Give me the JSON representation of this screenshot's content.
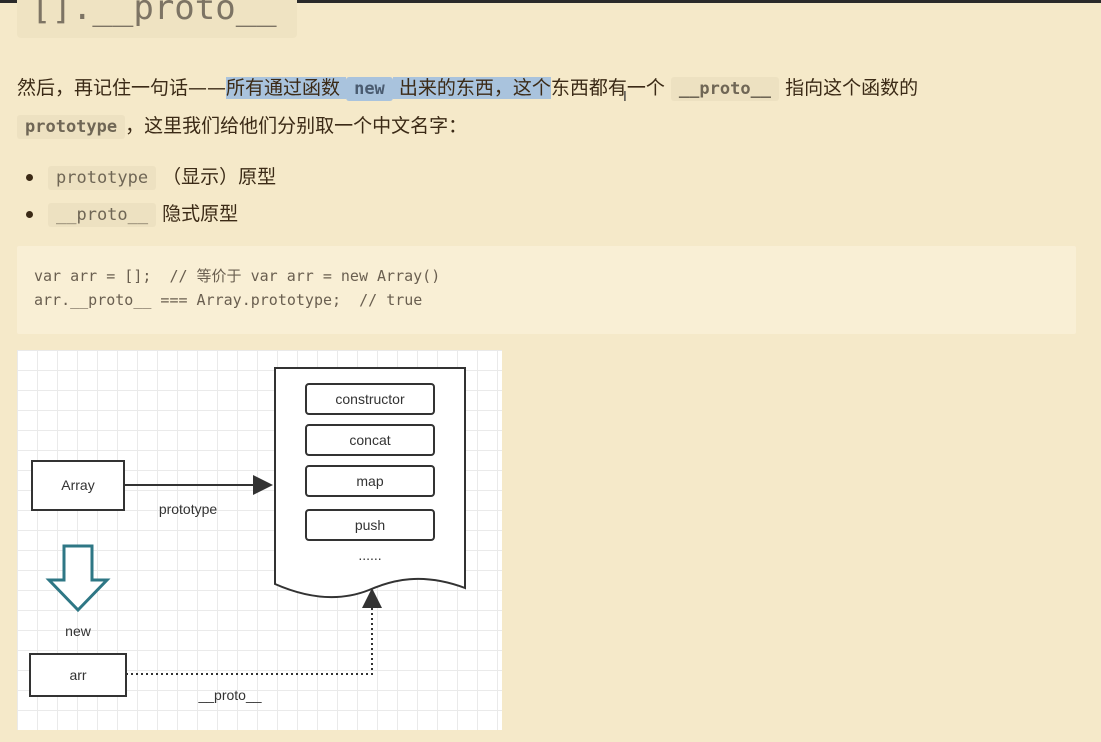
{
  "title": "[].__proto__",
  "paragraph": {
    "seg1": "然后，再记住一句话——",
    "seg2_hl": "所有通过函数",
    "code_new": "new",
    "seg3_hl": "出来的东西，这个",
    "seg4": "东西都有一个",
    "code_proto": "__proto__",
    "seg5": "指向这个函数的",
    "code_prototype": "prototype",
    "seg6": "，这里我们给他们分别取一个中文名字："
  },
  "bullets": [
    {
      "code": "prototype",
      "text": "（显示）原型"
    },
    {
      "code": "__proto__",
      "text": "隐式原型"
    }
  ],
  "code_lines": [
    "var arr = [];  // 等价于 var arr = new Array()",
    "arr.__proto__ === Array.prototype;  // true"
  ],
  "diagram": {
    "array_label": "Array",
    "prototype_label": "prototype",
    "new_label": "new",
    "arr_label": "arr",
    "proto_label": "__proto__",
    "methods": [
      "constructor",
      "concat",
      "map",
      "push"
    ],
    "ellipsis": "......"
  },
  "colors": {
    "background": "#f5e9c9",
    "highlight": "#a9c3dd",
    "code_bg": "#f9efd5",
    "arrow_teal": "#2e7785"
  }
}
